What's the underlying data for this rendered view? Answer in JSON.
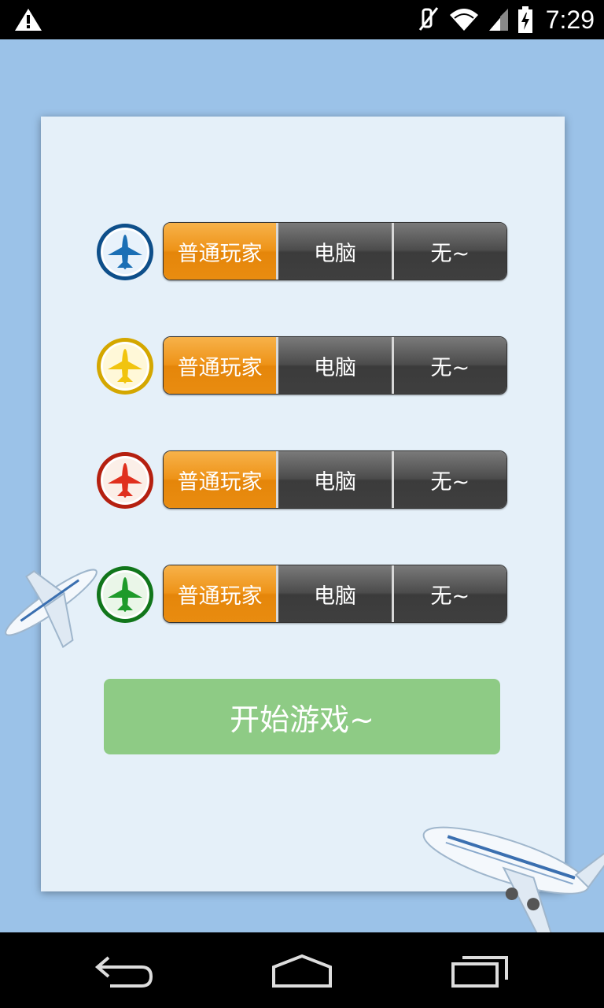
{
  "status_bar": {
    "time": "7:29",
    "icons": [
      "warning-icon",
      "mute-icon",
      "wifi-icon",
      "signal-icon",
      "battery-charging-icon"
    ]
  },
  "players": [
    {
      "color": "#1b6fb5",
      "ring": "#0e4f8a",
      "icon": "blue-plane-icon",
      "options": [
        "普通玩家",
        "电脑",
        "无~"
      ],
      "selected": 0
    },
    {
      "color": "#f1c40f",
      "ring": "#d4a700",
      "icon": "yellow-plane-icon",
      "options": [
        "普通玩家",
        "电脑",
        "无~"
      ],
      "selected": 0
    },
    {
      "color": "#e0301e",
      "ring": "#b52010",
      "icon": "red-plane-icon",
      "options": [
        "普通玩家",
        "电脑",
        "无~"
      ],
      "selected": 0
    },
    {
      "color": "#1e9a2a",
      "ring": "#11761b",
      "icon": "green-plane-icon",
      "options": [
        "普通玩家",
        "电脑",
        "无~"
      ],
      "selected": 0
    }
  ],
  "start_button": {
    "label": "开始游戏~"
  },
  "nav_bar": {
    "icons": [
      "back-icon",
      "home-icon",
      "recents-icon"
    ]
  }
}
